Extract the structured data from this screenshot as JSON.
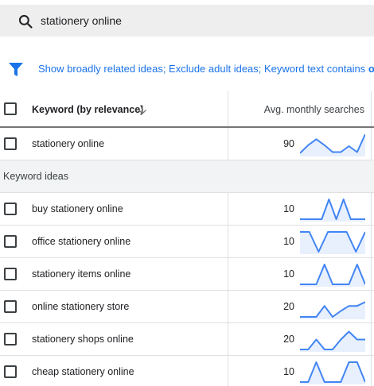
{
  "search": {
    "query": "stationery online",
    "icon": "search-icon"
  },
  "filters": {
    "text": "Show broadly related ideas;  Exclude adult ideas; Keyword text contains",
    "trailing_bold": "on"
  },
  "table": {
    "header": {
      "keyword_label": "Keyword (by relevance)",
      "avg_label": "Avg. monthly searches"
    },
    "primary": {
      "keyword": "stationery online",
      "avg": "90",
      "trend": [
        0.05,
        0.45,
        0.75,
        0.45,
        0.1,
        0.1,
        0.4,
        0.1,
        1.0
      ]
    },
    "group_label": "Keyword ideas",
    "ideas": [
      {
        "keyword": "buy stationery online",
        "avg": "10",
        "trend": [
          0,
          0,
          0,
          0,
          1,
          0,
          1,
          0,
          0,
          0
        ]
      },
      {
        "keyword": "office stationery online",
        "avg": "10",
        "trend": [
          1,
          1,
          0,
          1,
          1,
          1,
          0,
          1
        ]
      },
      {
        "keyword": "stationery items online",
        "avg": "10",
        "trend": [
          0,
          0,
          0,
          1,
          0,
          0,
          0,
          1,
          0
        ]
      },
      {
        "keyword": "online stationery store",
        "avg": "20",
        "trend": [
          0,
          0,
          0,
          0.55,
          0,
          0.3,
          0.55,
          0.55,
          0.75
        ]
      },
      {
        "keyword": "stationery shops online",
        "avg": "20",
        "trend": [
          0,
          0,
          0.5,
          0,
          0,
          0.5,
          0.9,
          0.5,
          0.5
        ]
      },
      {
        "keyword": "cheap stationery online",
        "avg": "10",
        "trend": [
          0,
          0,
          1,
          0,
          0,
          0,
          1,
          1,
          0
        ]
      }
    ]
  },
  "colors": {
    "accent": "#1a73e8",
    "spark_line": "#4285f4",
    "spark_fill": "#e8f0fe"
  }
}
